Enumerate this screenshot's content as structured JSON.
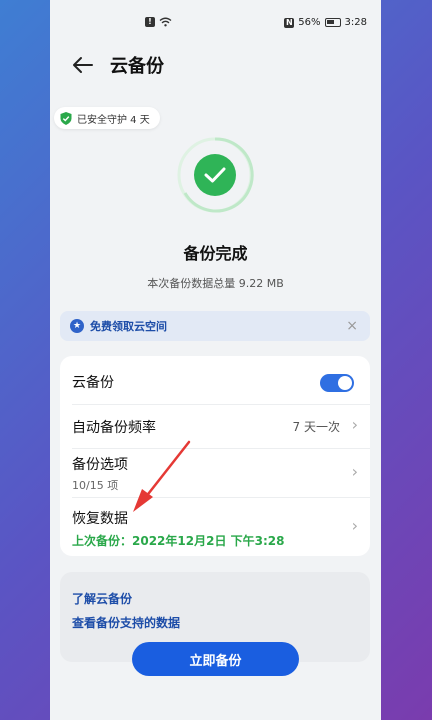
{
  "status": {
    "battery": "56%",
    "time": "3:28",
    "nfc": "N"
  },
  "header": {
    "title": "云备份"
  },
  "badge": {
    "text": "已安全守护 4 天"
  },
  "result": {
    "title": "备份完成",
    "subtitle": "本次备份数据总量 9.22 MB"
  },
  "promo": {
    "text": "免费领取云空间",
    "close": "×"
  },
  "settings": {
    "cloud_backup": {
      "label": "云备份",
      "enabled": true
    },
    "frequency": {
      "label": "自动备份频率",
      "value": "7 天一次"
    },
    "options": {
      "label": "备份选项",
      "sub": "10/15 项"
    },
    "restore": {
      "label": "恢复数据",
      "sub": "上次备份：2022年12月2日 下午3:28"
    }
  },
  "info": {
    "learn": "了解云备份",
    "supported": "查看备份支持的数据"
  },
  "action": {
    "backup_now": "立即备份"
  },
  "colors": {
    "accent": "#1a5ee0",
    "success": "#2aa84a",
    "annotation": "#e53935"
  }
}
